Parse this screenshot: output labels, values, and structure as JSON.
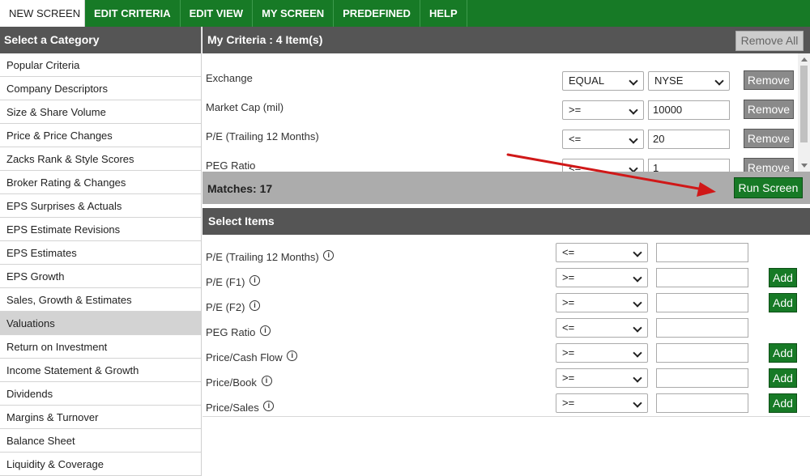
{
  "nav": {
    "tabs": [
      "NEW SCREEN",
      "EDIT CRITERIA",
      "EDIT VIEW",
      "MY SCREEN",
      "PREDEFINED",
      "HELP"
    ]
  },
  "sidebar": {
    "title": "Select a Category",
    "categories": [
      "Popular Criteria",
      "Company Descriptors",
      "Size & Share Volume",
      "Price & Price Changes",
      "Zacks Rank & Style Scores",
      "Broker Rating & Changes",
      "EPS Surprises & Actuals",
      "EPS Estimate Revisions",
      "EPS Estimates",
      "EPS Growth",
      "Sales, Growth & Estimates",
      "Valuations",
      "Return on Investment",
      "Income Statement & Growth",
      "Dividends",
      "Margins & Turnover",
      "Balance Sheet",
      "Liquidity & Coverage"
    ],
    "active": "Valuations"
  },
  "criteria": {
    "title": "My Criteria : 4 Item(s)",
    "remove_all_label": "Remove All",
    "remove_label": "Remove",
    "rows": [
      {
        "label": "Exchange",
        "operator": "EQUAL",
        "value": "NYSE",
        "value_is_select": true
      },
      {
        "label": "Market Cap (mil)",
        "operator": ">=",
        "value": "10000",
        "value_is_select": false
      },
      {
        "label": "P/E (Trailing 12 Months)",
        "operator": "<=",
        "value": "20",
        "value_is_select": false
      },
      {
        "label": "PEG Ratio",
        "operator": "<=",
        "value": "1",
        "value_is_select": false
      }
    ],
    "matches": "Matches: 17",
    "run_label": "Run Screen"
  },
  "select_items": {
    "title": "Select Items",
    "add_label": "Add",
    "info_glyph": "i",
    "rows": [
      {
        "label": "P/E (Trailing 12 Months)",
        "operator": "<=",
        "has_add": false
      },
      {
        "label": "P/E (F1)",
        "operator": ">=",
        "has_add": true
      },
      {
        "label": "P/E (F2)",
        "operator": ">=",
        "has_add": true
      },
      {
        "label": "PEG Ratio",
        "operator": "<=",
        "has_add": false
      },
      {
        "label": "Price/Cash Flow",
        "operator": ">=",
        "has_add": true
      },
      {
        "label": "Price/Book",
        "operator": ">=",
        "has_add": true
      },
      {
        "label": "Price/Sales",
        "operator": ">=",
        "has_add": true
      }
    ]
  },
  "colors": {
    "brand_green": "#177a26",
    "header_gray": "#555555",
    "annotation_arrow": "#d01818"
  }
}
